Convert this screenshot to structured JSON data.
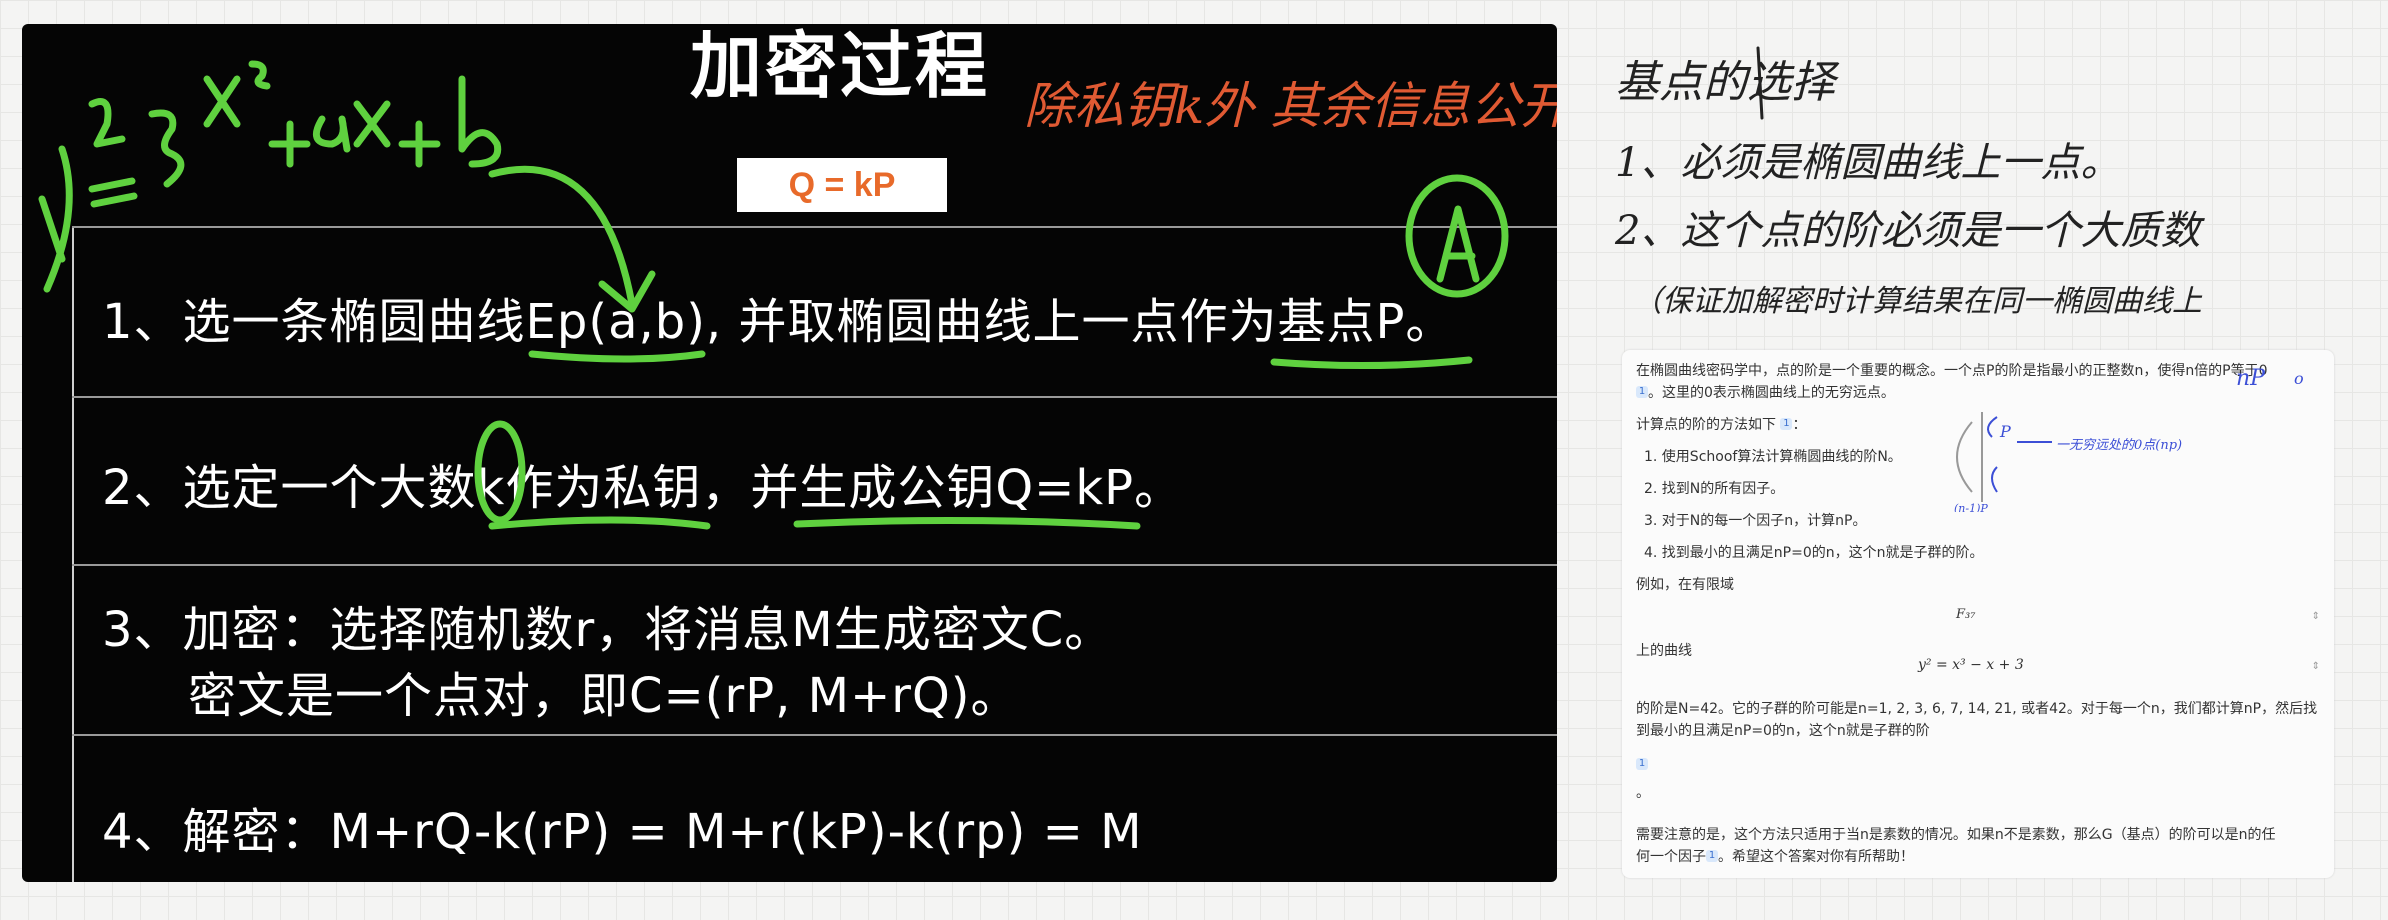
{
  "slide": {
    "title": "加密过程",
    "annotation_top": "除私钥k外 其余信息公开",
    "formula_box": "Q = kP",
    "rows": [
      "1、选一条椭圆曲线Ep(a,b), 并取椭圆曲线上一点作为基点P。",
      "2、选定一个大数k作为私钥，并生成公钥Q=kP。",
      "3、加密：选择随机数r，将消息M生成密文C。",
      "密文是一个点对，即C=(rP, M+rQ)。",
      "4、解密：M+rQ-k(rP) = M+r(kP)-k(rp) = M"
    ],
    "ink_equation": "y²=x³+ax+b",
    "ink_circle_letter": "A"
  },
  "notes": {
    "line1": "基点的选择",
    "line2": "1、必须是椭圆曲线上一点。",
    "line3": "2、这个点的阶必须是一个大质数",
    "line4": "（保证加解密时计算结果在同一椭圆曲线上",
    "margin_np": "nP",
    "margin_o": "o",
    "figure_label": "一无穷远处的0点(np)",
    "figure_point": "P",
    "figure_neg": "(n-1)P"
  },
  "answer": {
    "intro_1": "在椭圆曲线密码学中，点的阶是一个重要的概念。一个点P的阶是指最小的正整数n，使得n倍的P等于0",
    "intro_2": "。这里的0表示椭圆曲线上的无穷远点。",
    "method_title": "计算点的阶的方法如下",
    "cite": "1",
    "steps": [
      "1. 使用Schoof算法计算椭圆曲线的阶N。",
      "2. 找到N的所有因子。",
      "3. 对于N的每一个因子n，计算nP。",
      "4. 找到最小的且满足nP=0的n，这个n就是子群的阶。"
    ],
    "example": "例如，在有限域",
    "field": "F₃₇",
    "curve_label": "上的曲线",
    "curve": "y² = x³ − x + 3",
    "result_1": "的阶是N=42。它的子群的阶可能是n=1, 2, 3, 6, 7, 14, 21, 或者42。对于每一个n，我们都计算nP，然后找",
    "result_2": "到最小的且满足nP=0的n，这个n就是子群的阶",
    "dot": "。",
    "note_1": "需要注意的是，这个方法只适用于当n是素数的情况。如果n不是素数，那么G（基点）的阶可以是n的任",
    "note_2a": "何一个因子",
    "note_2b": "。希望这个答案对你有所帮助！"
  },
  "colors": {
    "slide_bg": "#050505",
    "ink_green": "#5fd13f",
    "ink_orange": "#e05a33",
    "formula": "#e86a2a",
    "ink_blue": "#3c4fd6"
  }
}
